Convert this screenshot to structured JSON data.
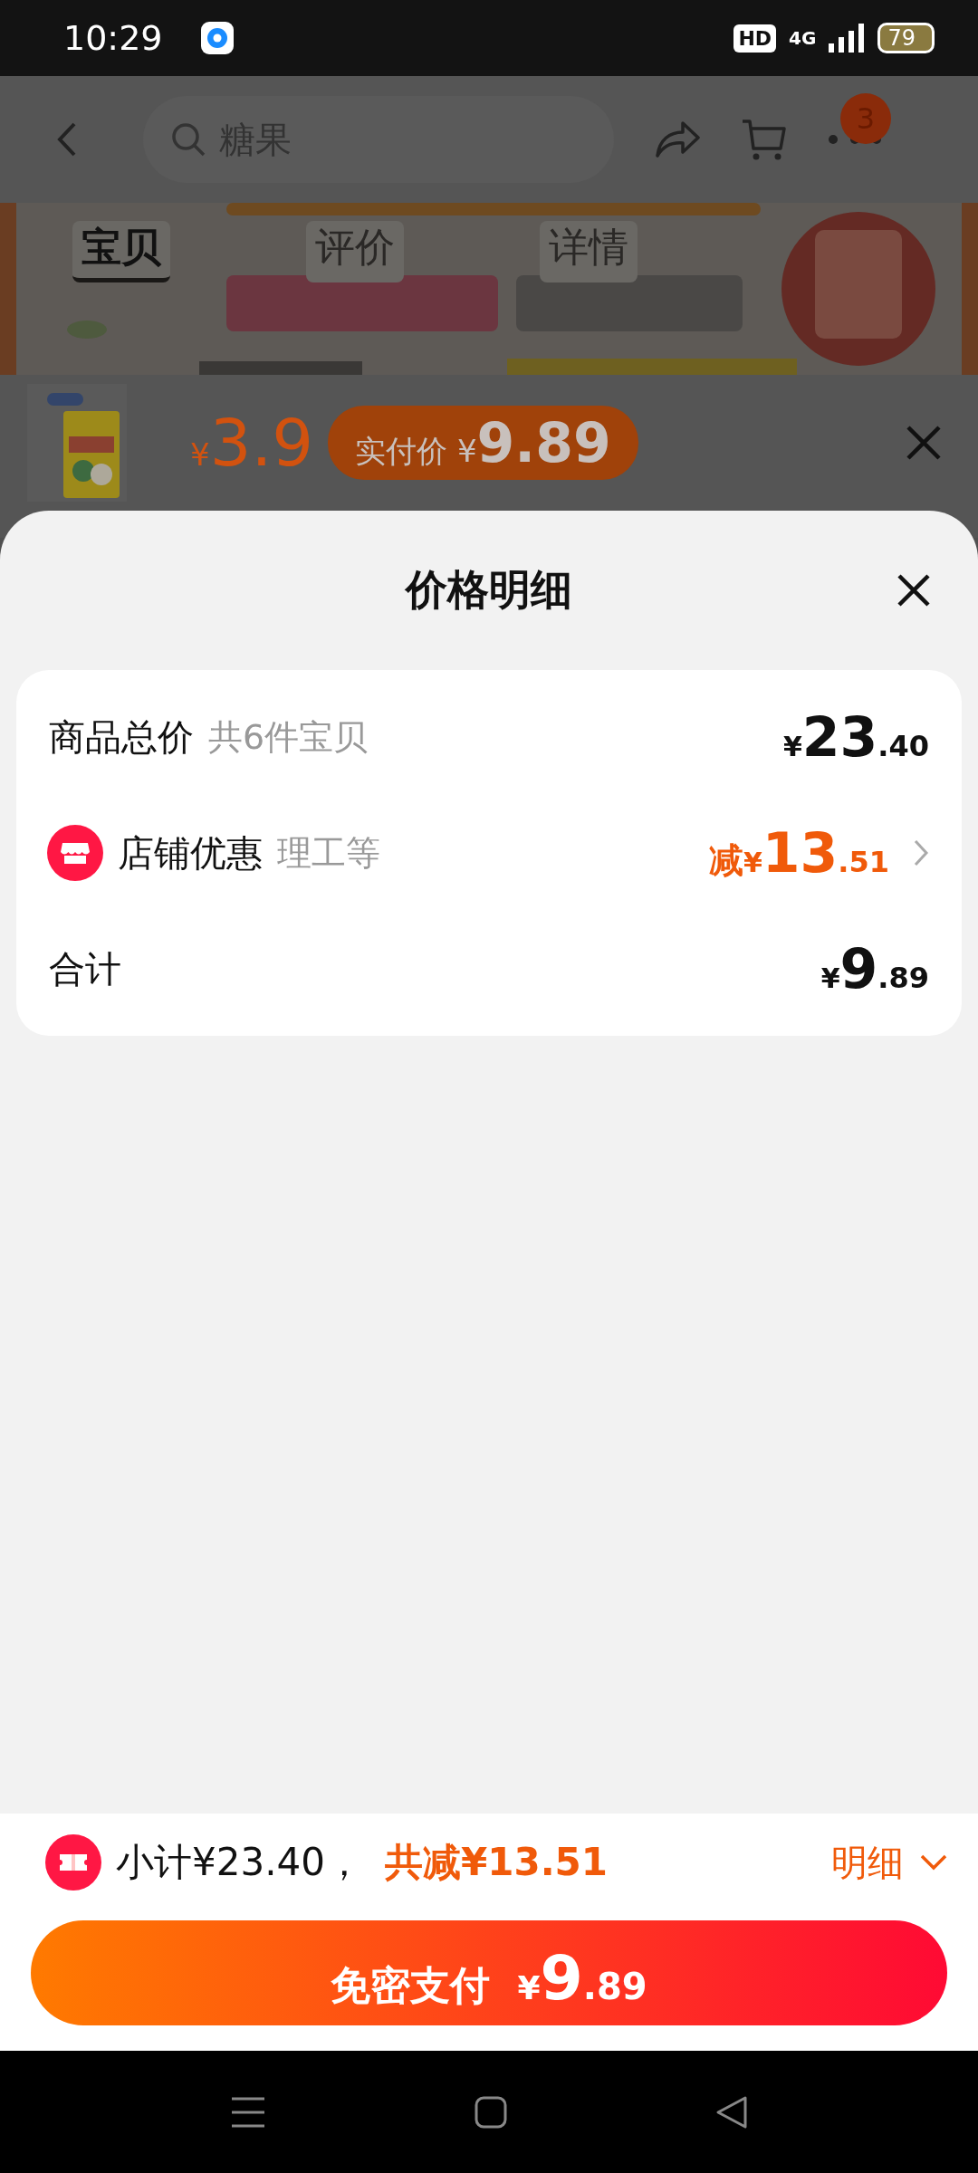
{
  "status_bar": {
    "time": "10:29",
    "hd": "HD",
    "network": "4G",
    "battery": "79"
  },
  "nav": {
    "query": "糖果",
    "cart_badge": "3"
  },
  "tabs": [
    {
      "label": "宝贝",
      "selected": true
    },
    {
      "label": "评价",
      "selected": false
    },
    {
      "label": "详情",
      "selected": false
    }
  ],
  "product": {
    "price_symbol": "¥",
    "price": "3.9",
    "paid_label": "实付价",
    "paid_symbol": "¥",
    "paid": "9.89"
  },
  "sheet": {
    "title": "价格明细",
    "rows": [
      {
        "kind": "total",
        "label": "商品总价",
        "note": "共6件宝贝",
        "symbol": "¥",
        "integer": "23",
        "decimal": ".40"
      },
      {
        "kind": "discount",
        "label": "店铺优惠",
        "note": "理工等",
        "prefix": "减",
        "symbol": "¥",
        "integer": "13",
        "decimal": ".51"
      },
      {
        "kind": "sum",
        "label": "合计",
        "symbol": "¥",
        "integer": "9",
        "decimal": ".89"
      }
    ]
  },
  "footer": {
    "subtotal": "小计¥23.40，",
    "savings": "共减¥13.51",
    "detail": "明细",
    "pay": {
      "label": "免密支付",
      "symbol": "¥",
      "integer": "9",
      "decimal": ".89"
    }
  }
}
